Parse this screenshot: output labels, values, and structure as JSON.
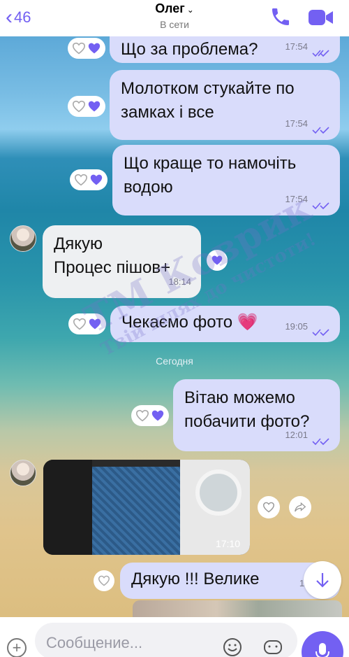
{
  "header": {
    "back_count": "46",
    "contact_name": "Олег",
    "status": "В сети"
  },
  "messages": [
    {
      "text": "Що за проблема?",
      "time": "17:54"
    },
    {
      "text_lines": [
        "Молотком стукайте по",
        "замках і все"
      ],
      "time": "17:54"
    },
    {
      "text_lines": [
        "Що краще то намочіть",
        "водою"
      ],
      "time": "17:54"
    },
    {
      "text_lines": [
        "Дякую",
        "Процес пішов+"
      ],
      "time": "18:14"
    },
    {
      "text": "Чекаємо фото",
      "emoji": "💗",
      "time": "19:05"
    },
    {
      "text_lines": [
        "Вітаю можемо",
        "побачити фото?"
      ],
      "time": "12:01"
    },
    {
      "photo_time": "17:10"
    },
    {
      "text": "Дякую !!! Велике",
      "time": "17:"
    }
  ],
  "date_separator": "Сегодня",
  "watermark": {
    "line1": "ТМ Коврик",
    "line2": "Твій шлях до чистоти!"
  },
  "input": {
    "placeholder": "Сообщение..."
  },
  "colors": {
    "accent": "#7360f2",
    "outgoing_bubble": "#d9dcfb",
    "incoming_bubble": "#eef0f2"
  }
}
